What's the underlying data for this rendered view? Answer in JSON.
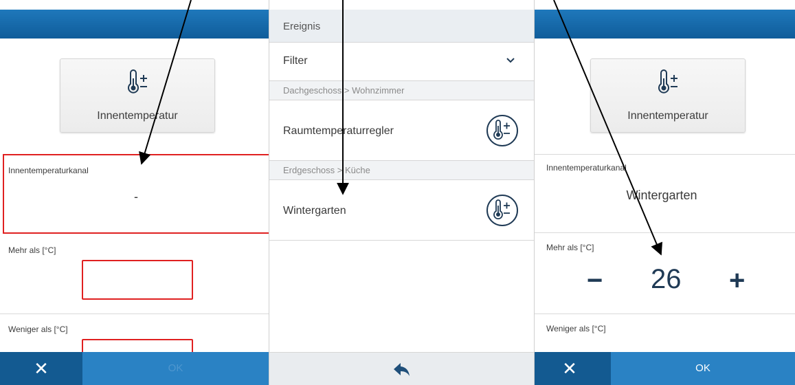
{
  "left_panel": {
    "tile_label": "Innentemperatur",
    "channel_label": "Innentemperaturkanal",
    "channel_value": "-",
    "more_than_label": "Mehr als [°C]",
    "less_than_label": "Weniger als [°C]",
    "close_symbol": "✕",
    "ok_label": "OK"
  },
  "middle_panel": {
    "header": "Ereignis",
    "filter_label": "Filter",
    "groups": [
      {
        "path": "Dachgeschoss > Wohnzimmer",
        "item": "Raumtemperaturregler"
      },
      {
        "path": "Erdgeschoss > Küche",
        "item": "Wintergarten"
      }
    ]
  },
  "right_panel": {
    "tile_label": "Innentemperatur",
    "channel_label": "Innentemperaturkanal",
    "channel_value": "Wintergarten",
    "more_than_label": "Mehr als [°C]",
    "more_than_value": "26",
    "minus_symbol": "−",
    "plus_symbol": "+",
    "less_than_label": "Weniger als [°C]",
    "close_symbol": "✕",
    "ok_label": "OK"
  },
  "colors": {
    "header_blue": "#1f78bb",
    "bottom_bar_blue": "#2a82c4",
    "close_button_blue": "#135a91",
    "error_red": "#e02020",
    "value_text": "#1f3a55"
  },
  "icons": {
    "thermometer": "thermometer-plus-minus-icon",
    "dropdown": "chevron-down-icon",
    "back": "back-arrow-icon",
    "close": "close-icon"
  }
}
